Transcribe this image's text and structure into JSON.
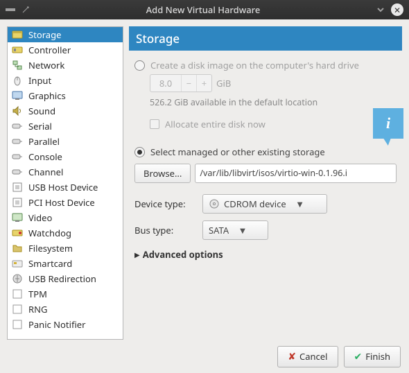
{
  "title": "Add New Virtual Hardware",
  "sidebar": {
    "items": [
      {
        "label": "Storage",
        "icon": "storage"
      },
      {
        "label": "Controller",
        "icon": "controller"
      },
      {
        "label": "Network",
        "icon": "network"
      },
      {
        "label": "Input",
        "icon": "input"
      },
      {
        "label": "Graphics",
        "icon": "graphics"
      },
      {
        "label": "Sound",
        "icon": "sound"
      },
      {
        "label": "Serial",
        "icon": "serial"
      },
      {
        "label": "Parallel",
        "icon": "serial"
      },
      {
        "label": "Console",
        "icon": "serial"
      },
      {
        "label": "Channel",
        "icon": "serial"
      },
      {
        "label": "USB Host Device",
        "icon": "host"
      },
      {
        "label": "PCI Host Device",
        "icon": "host"
      },
      {
        "label": "Video",
        "icon": "video"
      },
      {
        "label": "Watchdog",
        "icon": "watchdog"
      },
      {
        "label": "Filesystem",
        "icon": "fs"
      },
      {
        "label": "Smartcard",
        "icon": "smartcard"
      },
      {
        "label": "USB Redirection",
        "icon": "usbredir"
      },
      {
        "label": "TPM",
        "icon": "generic"
      },
      {
        "label": "RNG",
        "icon": "generic"
      },
      {
        "label": "Panic Notifier",
        "icon": "generic"
      }
    ],
    "selected": 0
  },
  "panel": {
    "heading": "Storage",
    "opt_create_label": "Create a disk image on the computer's hard drive",
    "size_value": "8.0",
    "size_unit": "GiB",
    "available_text": "526.2 GiB available in the default location",
    "allocate_label": "Allocate entire disk now",
    "opt_managed_label": "Select managed or other existing storage",
    "browse_label": "Browse...",
    "path_value": "/var/lib/libvirt/isos/virtio-win-0.1.96.i",
    "device_type_label": "Device type:",
    "device_type_value": "CDROM device",
    "bus_type_label": "Bus type:",
    "bus_type_value": "SATA",
    "advanced_label": "Advanced options"
  },
  "footer": {
    "cancel": "Cancel",
    "finish": "Finish"
  }
}
